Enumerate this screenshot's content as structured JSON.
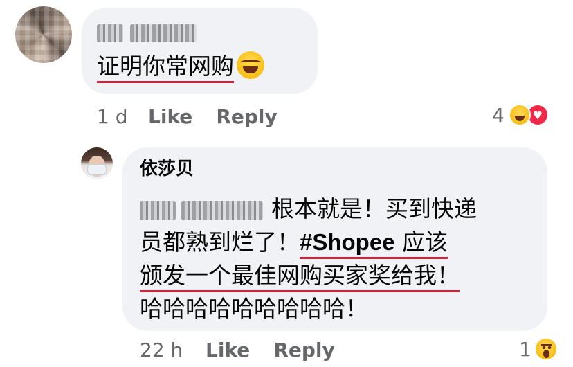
{
  "comment1": {
    "text": "证明你常网购",
    "time": "1 d",
    "like_label": "Like",
    "reply_label": "Reply",
    "reaction_count": "4",
    "reactions": [
      "haha-reaction-icon",
      "love-reaction-icon"
    ]
  },
  "comment2": {
    "author": "依莎贝",
    "line1_text": "根本就是！买到快递",
    "line2_text": "员都熟到烂了！",
    "hashtag": "#Shopee",
    "line2_tail": " 应该",
    "line3_text": "颁发一个最佳网购买家奖给我！",
    "line4_text": "哈哈哈哈哈哈哈哈哈！",
    "time": "22 h",
    "like_label": "Like",
    "reply_label": "Reply",
    "reaction_count": "1",
    "reactions": [
      "wow-reaction-icon"
    ]
  },
  "colors": {
    "bubble": "#f0f2f5",
    "meta_text": "#65676b",
    "underline": "#d0253a",
    "love": "#f02849",
    "emoji_yellow": "#ffd952"
  }
}
